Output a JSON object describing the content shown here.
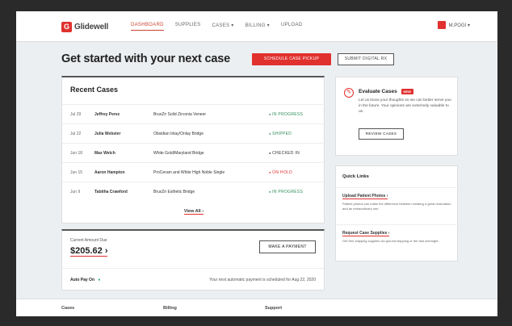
{
  "app": {
    "logo_text": "Glidewell",
    "nav": [
      "DASHBOARD",
      "SUPPLIES",
      "CASES ▾",
      "BILLING ▾",
      "UPLOAD"
    ],
    "user": "M.POGI ▾"
  },
  "page": {
    "headline": "Get started with your next case",
    "schedule_pickup": "SCHEDULE CASE PICKUP",
    "submit_digital": "SUBMIT DIGITAL RX"
  },
  "recent": {
    "title": "Recent Cases",
    "rows": [
      {
        "date": "Jul 29",
        "name": "Jeffrey Perez",
        "product": "BruxZir Solid Zirconia Veneer",
        "status": "IN PROGRESS"
      },
      {
        "date": "Jul 22",
        "name": "Julia Webster",
        "product": "Obsidian Inlay/Onlay Bridge",
        "status": "SHIPPED"
      },
      {
        "date": "Jun 18",
        "name": "Max Welch",
        "product": "White Gold/Maryland Bridge",
        "status": "CHECKED IN"
      },
      {
        "date": "Jun 15",
        "name": "Aaron Hampton",
        "product": "ProCeram and White High Noble Single",
        "status": "ON HOLD"
      },
      {
        "date": "Jun 9",
        "name": "Tabitha Crawford",
        "product": "BruxZir Esthetic Bridge",
        "status": "IN PROGRESS"
      }
    ],
    "view_all": "View All ›"
  },
  "amount": {
    "label": "Current Amount Due",
    "value": "$205.62 ›",
    "make_payment": "MAKE A PAYMENT",
    "autopay": "Auto Pay On",
    "autopay_note": "Your next automatic payment is scheduled for Aug 22, 2020"
  },
  "evaluate": {
    "title": "Evaluate Cases",
    "badge": "NEW",
    "text": "Let us know your thoughts so we can better serve you in the future. Your opinions are extremely valuable to us.",
    "button": "REVIEW CASES"
  },
  "quick": {
    "title": "Quick Links",
    "links": [
      {
        "title": "Upload Patient Photos ›",
        "text": "Patient photos can make the difference between creating a great restoration and an extraordinary one."
      },
      {
        "title": "Request Case Supplies ›",
        "text": "Get free shipping supplies via ground shipping or the fast overnight."
      }
    ]
  },
  "footer": [
    "Cases",
    "Billing",
    "Support"
  ],
  "colors": {
    "brand": "#e0312f",
    "status_green": "#2e8b57"
  }
}
